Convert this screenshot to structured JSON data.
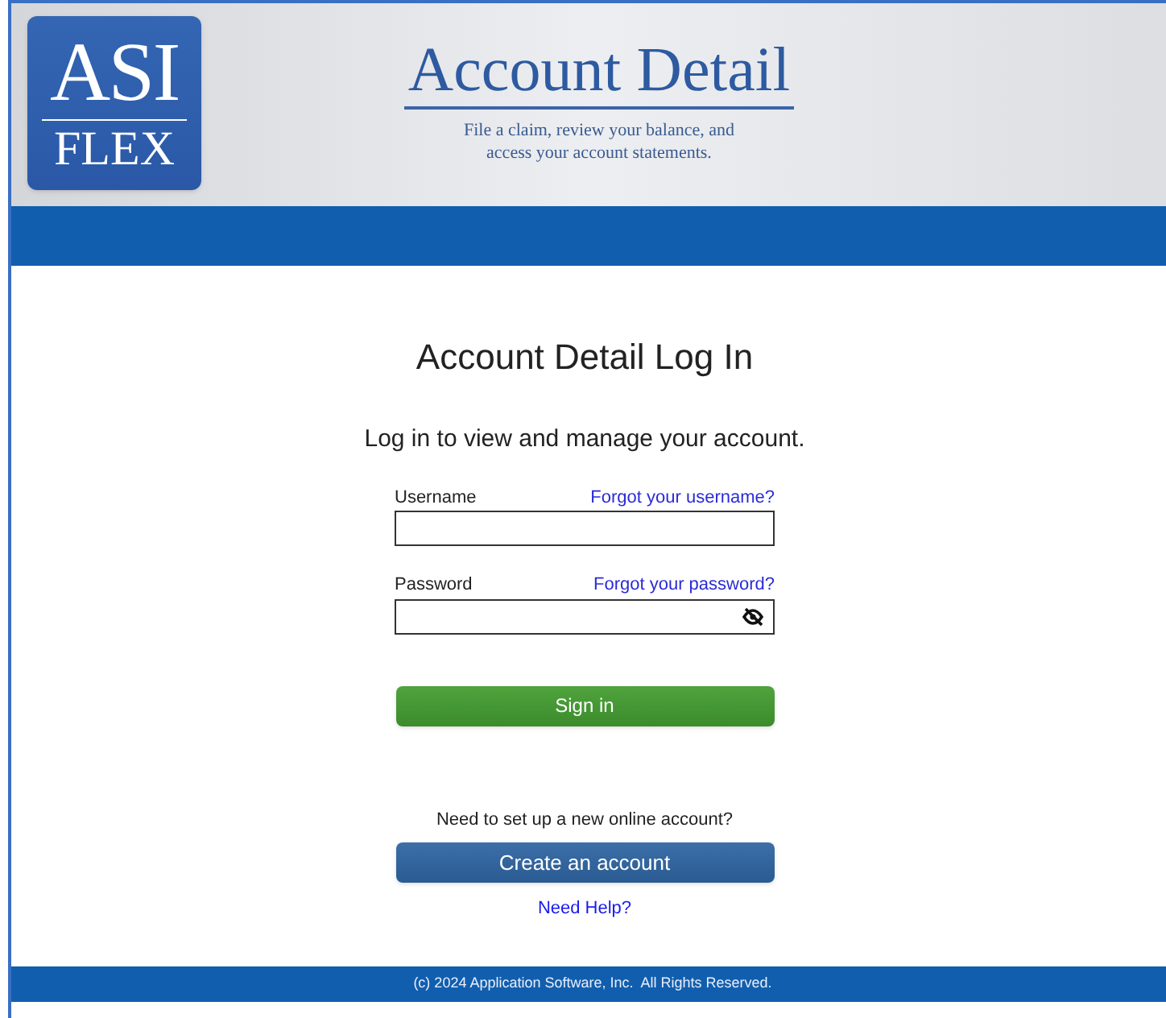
{
  "header": {
    "logo": {
      "top": "ASI",
      "bottom": "FLEX"
    },
    "title": "Account Detail",
    "subtitle": [
      "File a claim, review your balance, and",
      "access your account statements."
    ]
  },
  "login": {
    "heading": "Account Detail Log In",
    "intro": "Log in to view and manage your account.",
    "fields": [
      {
        "label": "Username",
        "link": "Forgot your username?",
        "kind": "text"
      },
      {
        "label": "Password",
        "link": "Forgot your password?",
        "kind": "password"
      }
    ],
    "sign_in": "Sign in",
    "signup_prompt": "Need to set up a new online account?",
    "create": "Create an account",
    "help": "Need Help?"
  },
  "footer": "(c) 2024 Application Software, Inc.  All Rights Reserved."
}
